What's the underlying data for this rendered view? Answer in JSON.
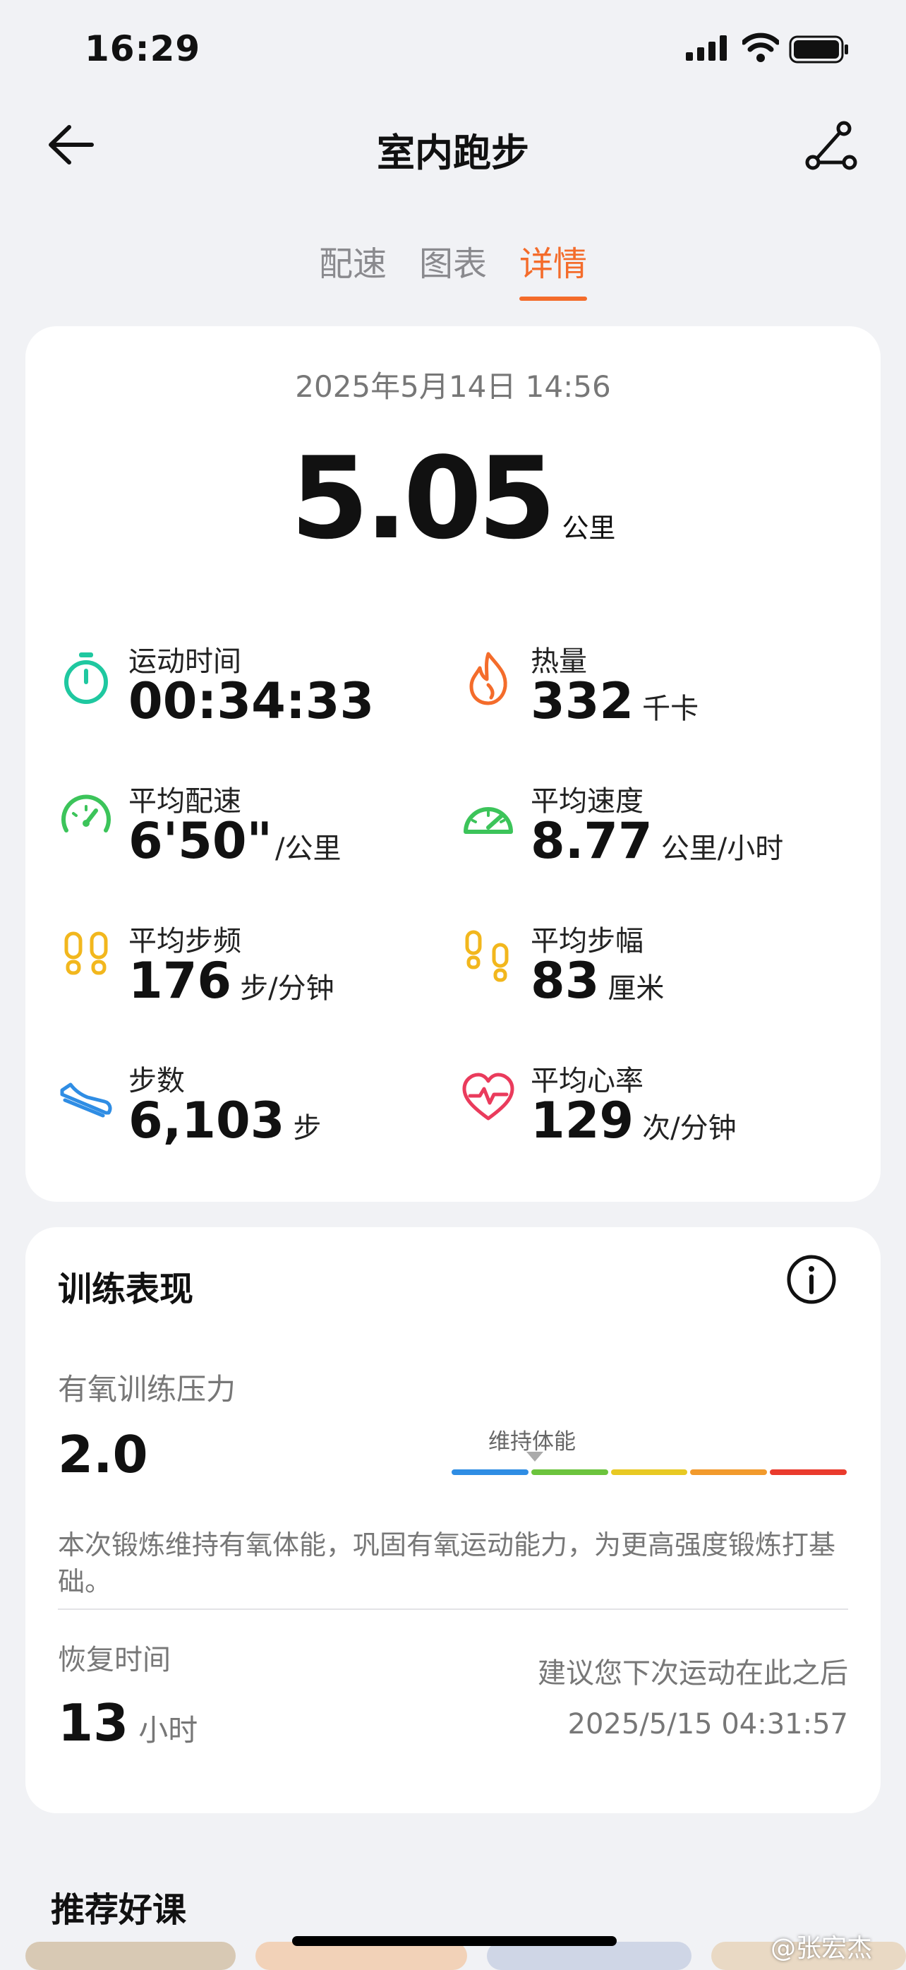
{
  "status": {
    "time": "16:29"
  },
  "nav": {
    "title": "室内跑步"
  },
  "tabs": [
    {
      "label": "配速",
      "active": false
    },
    {
      "label": "图表",
      "active": false
    },
    {
      "label": "详情",
      "active": true
    }
  ],
  "summary": {
    "date": "2025年5月14日 14:56",
    "distance": "5.05",
    "distance_unit": "公里",
    "metrics": [
      {
        "icon": "stopwatch-icon",
        "label": "运动时间",
        "value": "00:34:33",
        "unit": ""
      },
      {
        "icon": "flame-icon",
        "label": "热量",
        "value": "332",
        "unit": "千卡"
      },
      {
        "icon": "speedometer-icon",
        "label": "平均配速",
        "value": "6'50\"",
        "unit": "/公里"
      },
      {
        "icon": "gauge-icon",
        "label": "平均速度",
        "value": "8.77",
        "unit": "公里/小时"
      },
      {
        "icon": "footprints-icon",
        "label": "平均步频",
        "value": "176",
        "unit": "步/分钟"
      },
      {
        "icon": "footprints-icon",
        "label": "平均步幅",
        "value": "83",
        "unit": "厘米"
      },
      {
        "icon": "shoe-icon",
        "label": "步数",
        "value": "6,103",
        "unit": "步"
      },
      {
        "icon": "heart-rate-icon",
        "label": "平均心率",
        "value": "129",
        "unit": "次/分钟"
      }
    ]
  },
  "training": {
    "title": "训练表现",
    "aerobic_label": "有氧训练压力",
    "aerobic_value": "2.0",
    "scale_label": "维持体能",
    "scale_colors": [
      "#2f8de4",
      "#6cc43d",
      "#e8c923",
      "#f29a2c",
      "#ea3b2d"
    ],
    "description": "本次锻炼维持有氧体能，巩固有氧运动能力，为更高强度锻炼打基础。",
    "recovery_label": "恢复时间",
    "recovery_value": "13",
    "recovery_unit": "小时",
    "advice_line1": "建议您下次运动在此之后",
    "advice_line2": "2025/5/15 04:31:57"
  },
  "courses": {
    "title": "推荐好课"
  },
  "watermark": "@张宏杰"
}
